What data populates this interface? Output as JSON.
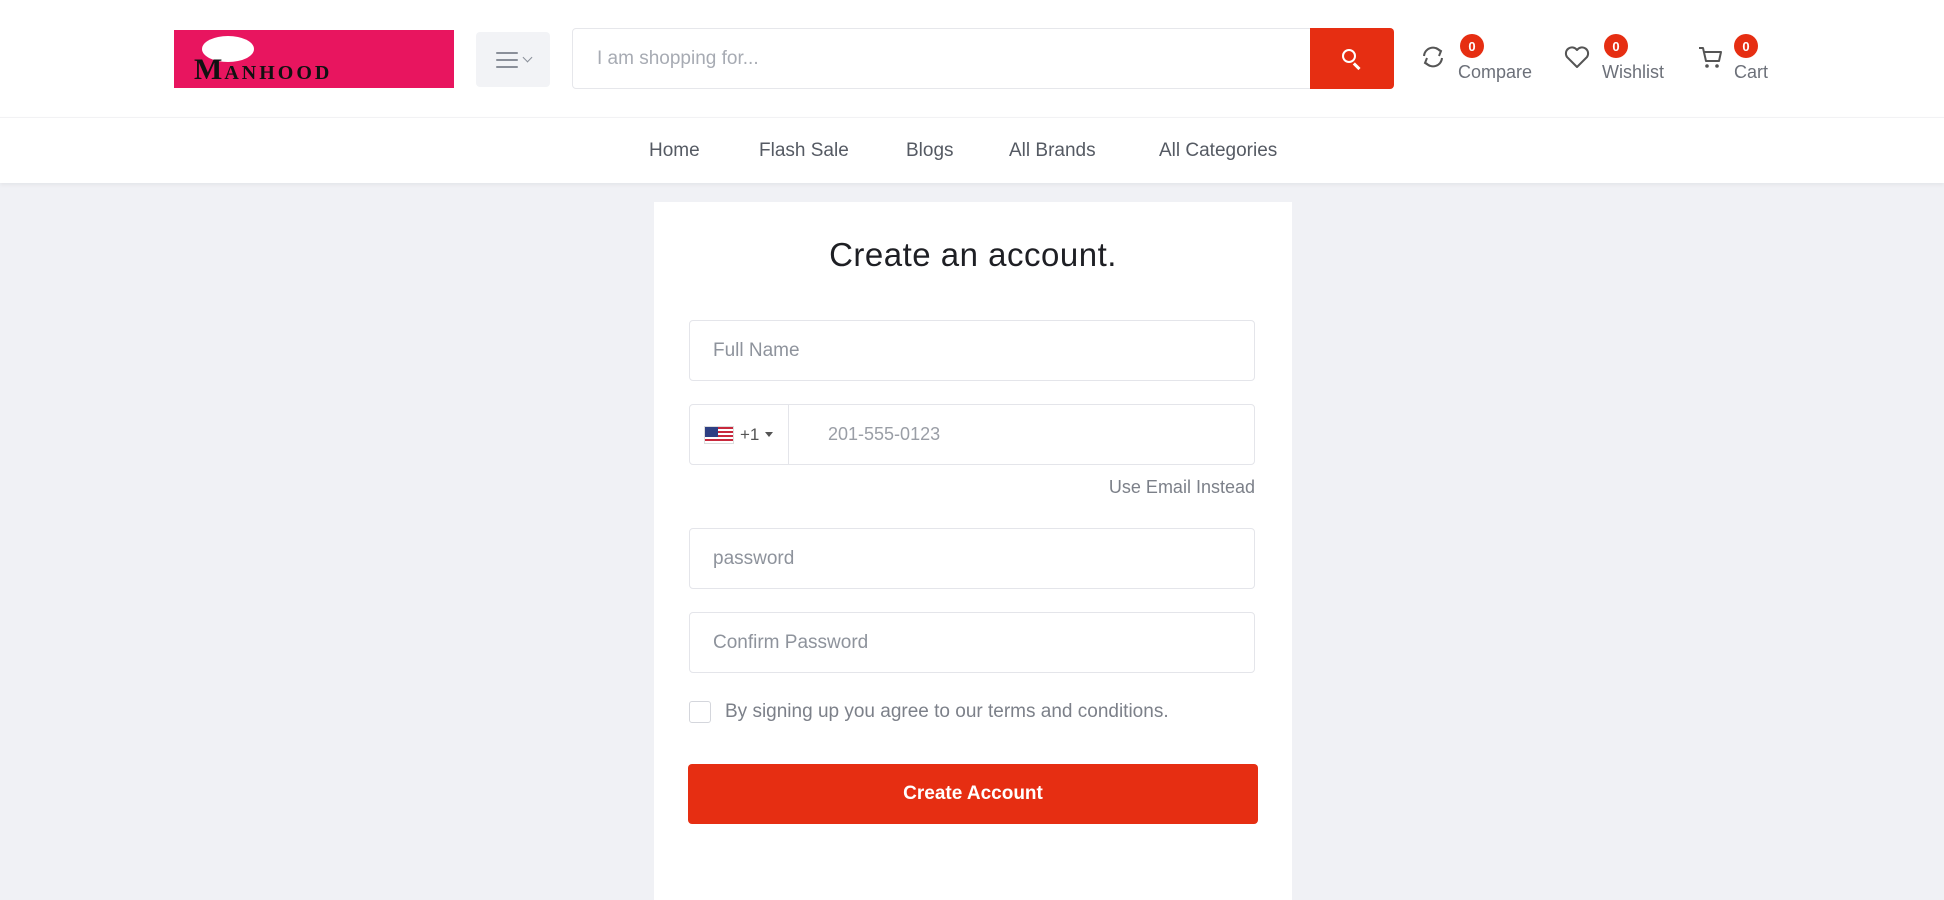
{
  "header": {
    "logo": {
      "letter": "M",
      "text": "ANHOOD"
    },
    "search": {
      "placeholder": "I am shopping for..."
    },
    "compare": {
      "label": "Compare",
      "count": "0"
    },
    "wishlist": {
      "label": "Wishlist",
      "count": "0"
    },
    "cart": {
      "label": "Cart",
      "count": "0"
    }
  },
  "nav": {
    "items": [
      "Home",
      "Flash Sale",
      "Blogs",
      "All Brands",
      "All Categories"
    ]
  },
  "form": {
    "title": "Create an account.",
    "full_name_placeholder": "Full Name",
    "country_code": "+1",
    "phone_placeholder": "201-555-0123",
    "use_email_label": "Use Email Instead",
    "password_placeholder": "password",
    "confirm_password_placeholder": "Confirm Password",
    "terms_label": "By signing up you agree to our terms and conditions.",
    "submit_label": "Create Account"
  },
  "colors": {
    "accent": "#e62e12",
    "logo_bg": "#e8155f",
    "page_bg": "#f0f1f5"
  }
}
